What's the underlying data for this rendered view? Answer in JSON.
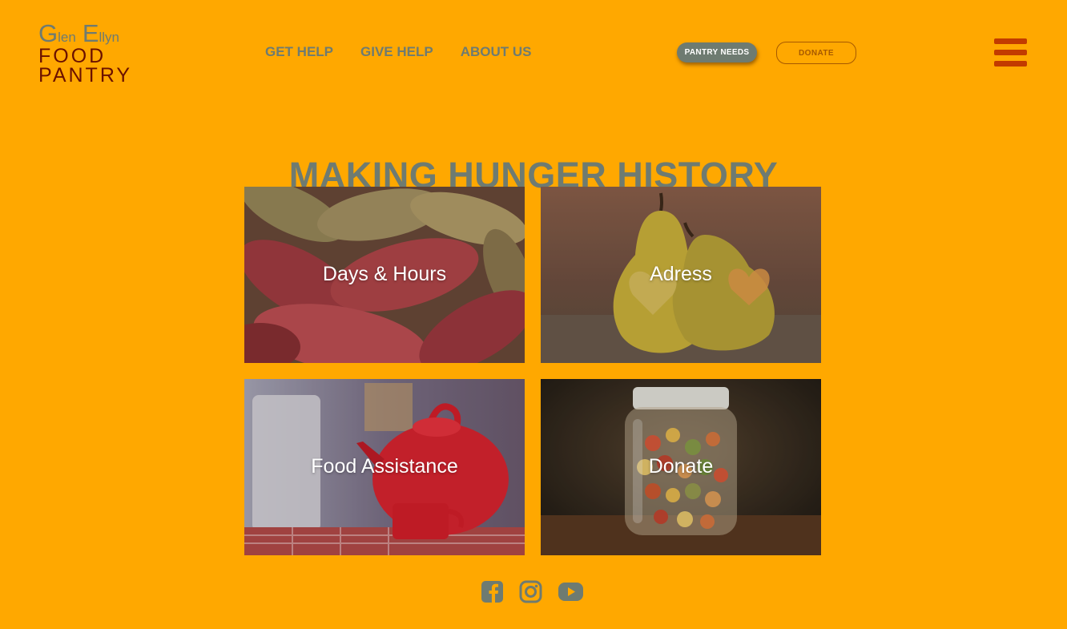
{
  "logo": {
    "g": "G",
    "len": "len",
    "e": "E",
    "llyn": "llyn",
    "line2": "FOOD",
    "line3": "PANTRY"
  },
  "nav": {
    "get_help": "GET HELP",
    "give_help": "GIVE HELP",
    "about_us": "ABOUT US"
  },
  "buttons": {
    "pantry_needs": "PANTRY NEEDS",
    "donate": "DONATE"
  },
  "hero": {
    "title": "MAKING HUNGER HISTORY"
  },
  "tiles": [
    {
      "label": "Days & Hours",
      "image": "sweet-potatoes-photo"
    },
    {
      "label": "Adress",
      "image": "pears-photo"
    },
    {
      "label": "Food Assistance",
      "image": "red-kettle-photo"
    },
    {
      "label": "Donate",
      "image": "pasta-jar-photo"
    }
  ],
  "social": [
    "facebook-icon",
    "instagram-icon",
    "youtube-icon"
  ],
  "colors": {
    "background": "#FFA800",
    "muted": "#6E7B71",
    "logo_dark": "#6B1100",
    "menu": "#C23B00",
    "donate_outline": "#A65900"
  }
}
